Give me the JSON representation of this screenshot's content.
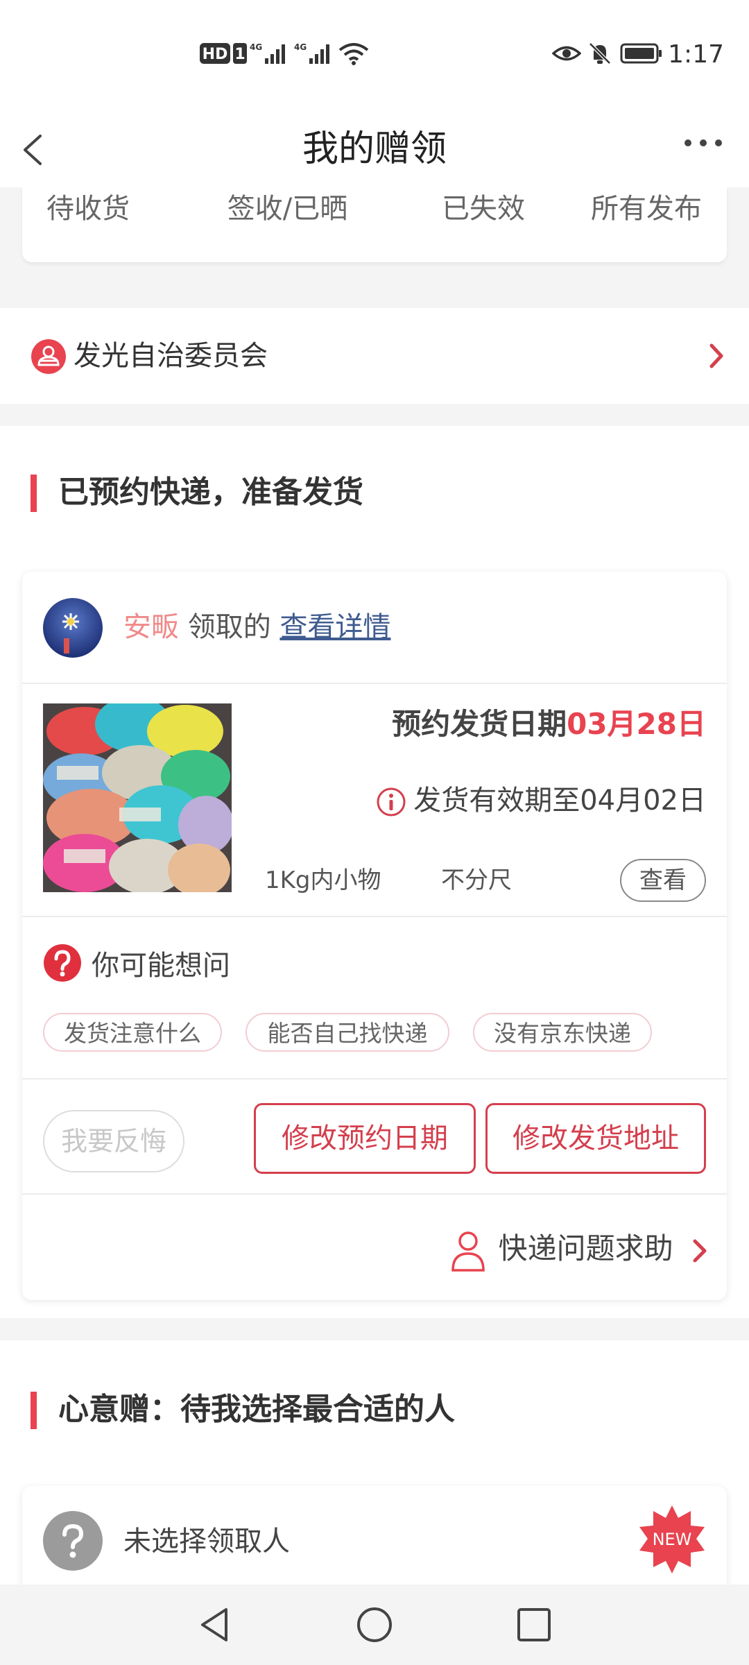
{
  "status_bar": {
    "time": "1:17",
    "hd_label": "HD",
    "sim_label": "1",
    "net1": "4G",
    "net2": "4G",
    "icons": [
      "hd-icon",
      "signal-icon",
      "signal-icon",
      "wifi-icon",
      "eye-icon",
      "mute-icon",
      "battery-icon"
    ]
  },
  "header": {
    "title": "我的赠领",
    "back_icon": "chevron-left-icon",
    "more_icon": "more-dots-icon"
  },
  "tabs": [
    "待收货",
    "签收/已晒",
    "已失效",
    "所有发布"
  ],
  "committee": {
    "label": "发光自治委员会",
    "icon": "committee-icon"
  },
  "shipping_section": {
    "title": "已预约快递，准备发货",
    "card": {
      "user_name": "安畈",
      "claim_text": "领取的",
      "detail_link": "查看详情",
      "date_label": "预约发货日期",
      "date_value": "03月28日",
      "validity": "发货有效期至04月02日",
      "item_weight": "1Kg内小物",
      "item_size": "不分尺",
      "view_label": "查看",
      "faq_title": "你可能想问",
      "faq_chips": [
        "发货注意什么",
        "能否自己找快递",
        "没有京东快递"
      ],
      "regret_label": "我要反悔",
      "change_date_label": "修改预约日期",
      "change_address_label": "修改发货地址",
      "help_label": "快递问题求助"
    }
  },
  "heart_section": {
    "title": "心意赠：待我选择最合适的人",
    "card": {
      "label": "未选择领取人",
      "badge": "NEW"
    }
  },
  "colors": {
    "accent": "#e8434f",
    "link": "#3f5b8f",
    "user_name": "#f08a8a"
  }
}
